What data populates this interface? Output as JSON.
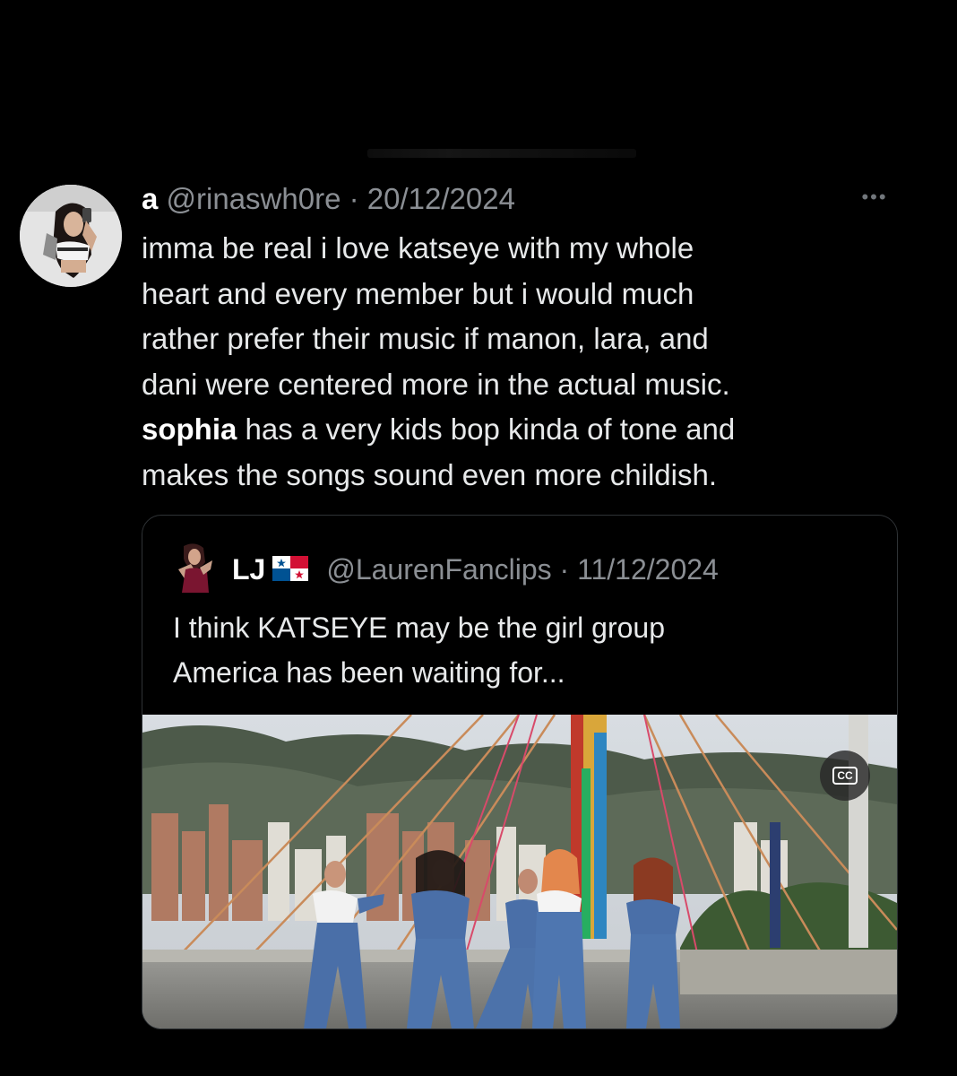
{
  "tweet": {
    "display_name": "a",
    "handle": "@rinaswh0re",
    "separator": "·",
    "date": "20/12/2024",
    "more_icon": "more-horizontal-icon",
    "text_lines": [
      "imma be real i love katseye with my whole",
      "heart and every member but i would much",
      "rather prefer their music if manon, lara, and",
      "dani were centered more in the actual music."
    ],
    "text_bold": "sophia",
    "text_line5_rest": " has a very kids bop kinda of tone and",
    "text_line6": "makes the songs sound even more childish."
  },
  "quoted_tweet": {
    "display_name": "LJ",
    "flag_icon": "panama-flag-icon",
    "handle": "@LaurenFanclips",
    "separator": "·",
    "date": "11/12/2024",
    "text_line1": "I think KATSEYE may be the girl group",
    "text_line2": "America has been waiting for...",
    "media": {
      "type": "video",
      "caption_button_label": "CC"
    }
  },
  "colors": {
    "background": "#000000",
    "text": "#e7e9ea",
    "muted": "#8b8f94",
    "border": "#2f3336"
  }
}
